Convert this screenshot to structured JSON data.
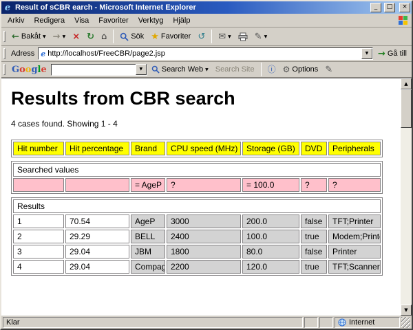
{
  "window": {
    "title": "Result of sCBR earch - Microsoft Internet Explorer"
  },
  "menu": [
    "Arkiv",
    "Redigera",
    "Visa",
    "Favoriter",
    "Verktyg",
    "Hjälp"
  ],
  "toolbar": {
    "back": "Bakåt",
    "search": "Sök",
    "favorites": "Favoriter"
  },
  "address": {
    "label": "Adress",
    "value": "http://localhost/FreeCBR/page2.jsp",
    "go_label": "Gå till"
  },
  "google": {
    "letters": [
      "G",
      "o",
      "o",
      "g",
      "l",
      "e"
    ],
    "query": "",
    "search_web": "Search Web",
    "search_site": "Search Site",
    "options": "Options"
  },
  "page": {
    "heading": "Results from CBR search",
    "count_text": "4 cases found. Showing 1 - 4"
  },
  "table": {
    "headers": [
      "Hit number",
      "Hit percentage",
      "Brand",
      "CPU speed (MHz)",
      "Storage (GB)",
      "DVD",
      "Peripherals"
    ],
    "searched_section": "Searched values",
    "searched": [
      "",
      "",
      "= AgeP",
      "?",
      "= 100.0",
      "?",
      "?"
    ],
    "results_section": "Results",
    "rows": [
      [
        "1",
        "70.54",
        "AgeP",
        "3000",
        "200.0",
        "false",
        "TFT;Printer"
      ],
      [
        "2",
        "29.29",
        "BELL",
        "2400",
        "100.0",
        "true",
        "Modem;Printer"
      ],
      [
        "3",
        "29.04",
        "JBM",
        "1800",
        "80.0",
        "false",
        "Printer"
      ],
      [
        "4",
        "29.04",
        "Compag",
        "2200",
        "120.0",
        "true",
        "TFT;Scanner"
      ]
    ]
  },
  "status": {
    "text": "Klar",
    "zone": "Internet"
  },
  "icons": {
    "minimize": "_",
    "maximize": "□",
    "close": "×",
    "back": "←",
    "forward": "→",
    "dropdown": "▼",
    "stop": "×",
    "refresh": "↻",
    "home": "⌂",
    "favorites": "★",
    "history": "↺",
    "mail": "✉",
    "edit": "✎",
    "go": "→",
    "info": "ⓘ",
    "gear": "⚙",
    "scroll_up": "▲",
    "scroll_down": "▼"
  },
  "colors": {
    "titlebar_start": "#0a246a",
    "titlebar_end": "#a6caf0",
    "chrome_gray": "#d4d0c8",
    "header_yellow": "#ffff00",
    "searched_pink": "#ffc0cb",
    "result_gray": "#d3d3d3"
  }
}
